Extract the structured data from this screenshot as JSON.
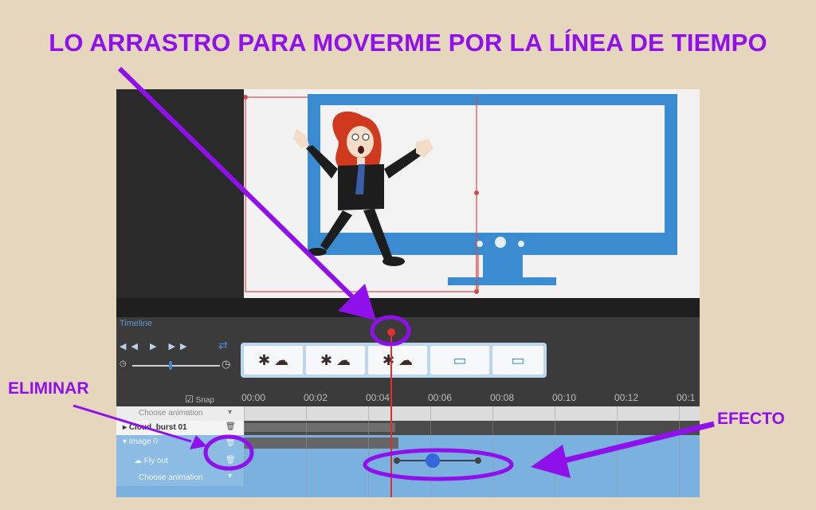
{
  "annotations": {
    "title": "LO ARRASTRO PARA MOVERME POR LA LÍNEA DE TIEMPO",
    "eliminar": "ELIMINAR",
    "efecto": "EFECTO",
    "color": "#8f10ea"
  },
  "timeline": {
    "title": "Timeline",
    "transport_icons": [
      "rewind-icon",
      "play-icon",
      "fast-forward-icon",
      "loop-icon"
    ],
    "snap_label": "Snap",
    "ticks": [
      "00:00",
      "00:02",
      "00:04",
      "00:06",
      "00:08",
      "00:10",
      "00:12",
      "00:1"
    ],
    "rows": [
      {
        "label": "Choose animation"
      },
      {
        "label": "Cloud_burst 01"
      },
      {
        "label": "Image 0"
      },
      {
        "label": "Fly out"
      },
      {
        "label": "Choose animation"
      }
    ]
  },
  "colors": {
    "canvas_frame": "#3b8bd0",
    "playhead": "#dd3030",
    "track_selected": "#7ab1df"
  }
}
